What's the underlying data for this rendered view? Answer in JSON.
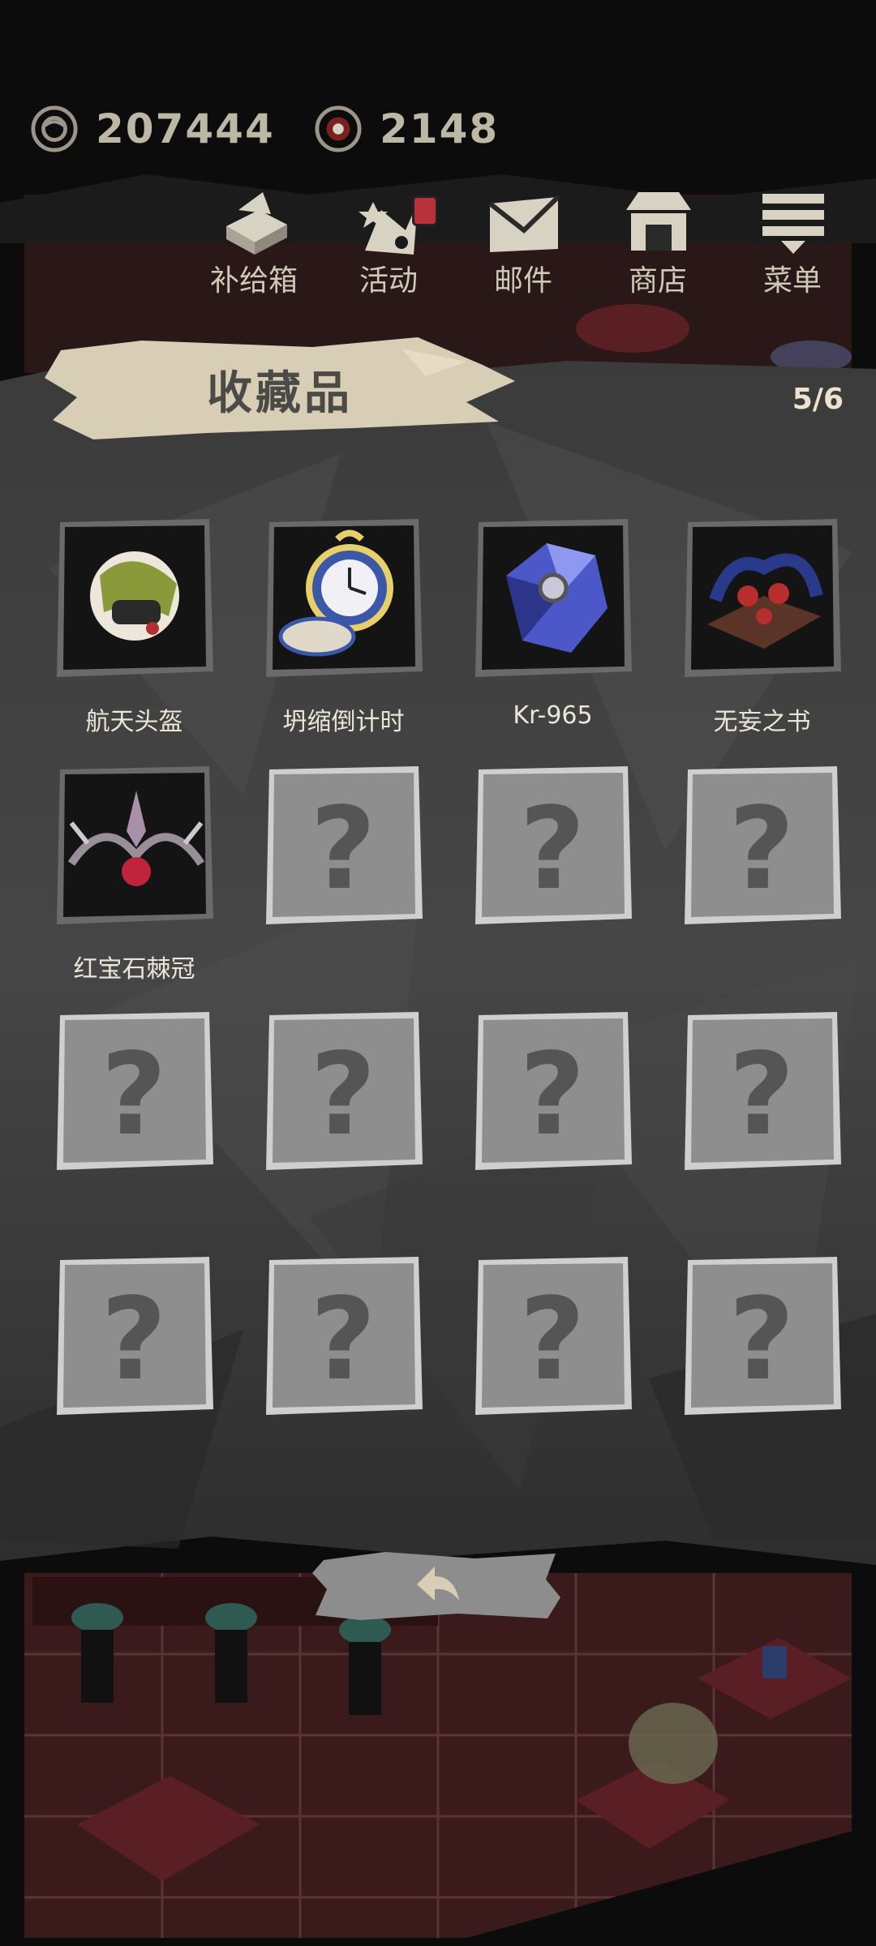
{
  "currencies": [
    {
      "icon": "gear-coin-icon",
      "value": "207444"
    },
    {
      "icon": "eye-coin-icon",
      "value": "2148"
    }
  ],
  "nav": [
    {
      "id": "supply",
      "label": "补给箱",
      "icon": "supply-box-icon",
      "badge": false
    },
    {
      "id": "events",
      "label": "活动",
      "icon": "event-icon",
      "badge": true
    },
    {
      "id": "mail",
      "label": "邮件",
      "icon": "mail-icon",
      "badge": false
    },
    {
      "id": "shop",
      "label": "商店",
      "icon": "shop-icon",
      "badge": false
    },
    {
      "id": "menu",
      "label": "菜单",
      "icon": "menu-icon",
      "badge": false
    }
  ],
  "panel": {
    "title": "收藏品",
    "count": "5/6"
  },
  "collection": [
    {
      "name": "航天头盔",
      "icon": "space-helmet-icon",
      "unlocked": true
    },
    {
      "name": "坍缩倒计时",
      "icon": "pocket-watch-icon",
      "unlocked": true
    },
    {
      "name": "Kr-965",
      "icon": "crystal-icon",
      "unlocked": true
    },
    {
      "name": "无妄之书",
      "icon": "cursed-book-icon",
      "unlocked": true
    },
    {
      "name": "红宝石棘冠",
      "icon": "ruby-crown-icon",
      "unlocked": true
    },
    {
      "name": "",
      "icon": "question-mark-icon",
      "unlocked": false
    },
    {
      "name": "",
      "icon": "question-mark-icon",
      "unlocked": false
    },
    {
      "name": "",
      "icon": "question-mark-icon",
      "unlocked": false
    },
    {
      "name": "",
      "icon": "question-mark-icon",
      "unlocked": false
    },
    {
      "name": "",
      "icon": "question-mark-icon",
      "unlocked": false
    },
    {
      "name": "",
      "icon": "question-mark-icon",
      "unlocked": false
    },
    {
      "name": "",
      "icon": "question-mark-icon",
      "unlocked": false
    },
    {
      "name": "",
      "icon": "question-mark-icon",
      "unlocked": false
    },
    {
      "name": "",
      "icon": "question-mark-icon",
      "unlocked": false
    },
    {
      "name": "",
      "icon": "question-mark-icon",
      "unlocked": false
    },
    {
      "name": "",
      "icon": "question-mark-icon",
      "unlocked": false
    }
  ],
  "back_button": {
    "icon": "back-arrow-icon"
  }
}
